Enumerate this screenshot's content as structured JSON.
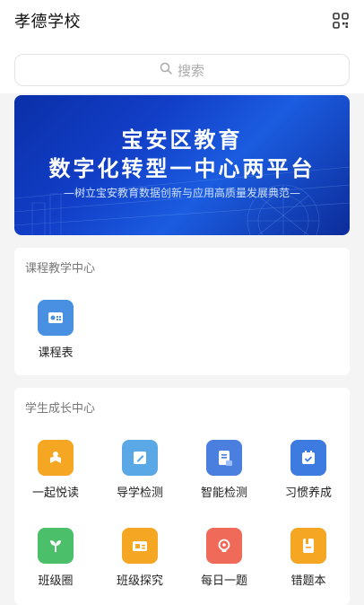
{
  "header": {
    "title": "孝德学校",
    "scan_icon": "grid-qr-icon"
  },
  "search": {
    "placeholder": "搜索",
    "icon": "search-icon"
  },
  "banner": {
    "line1": "宝安区教育",
    "line2": "数字化转型一中心两平台",
    "subtitle": "—树立宝安教育数据创新与应用高质量发展典范—"
  },
  "course_section": {
    "title": "课程教学中心",
    "items": [
      {
        "label": "课程表",
        "icon": "schedule-icon",
        "color": "#4a90e2"
      }
    ]
  },
  "growth_section": {
    "title": "学生成长中心",
    "items": [
      {
        "label": "一起悦读",
        "icon": "reading-icon",
        "color": "#f5a623"
      },
      {
        "label": "导学检测",
        "icon": "pencil-note-icon",
        "color": "#5aa9e6"
      },
      {
        "label": "智能检测",
        "icon": "smart-test-icon",
        "color": "#4a7fe0"
      },
      {
        "label": "习惯养成",
        "icon": "calendar-check-icon",
        "color": "#3d7be0"
      },
      {
        "label": "班级圈",
        "icon": "sprout-icon",
        "color": "#4cbf6a"
      },
      {
        "label": "班级探究",
        "icon": "explore-card-icon",
        "color": "#f5a623"
      },
      {
        "label": "每日一题",
        "icon": "lightbulb-icon",
        "color": "#f06a5a"
      },
      {
        "label": "错题本",
        "icon": "mistake-book-icon",
        "color": "#f5a623"
      }
    ]
  }
}
